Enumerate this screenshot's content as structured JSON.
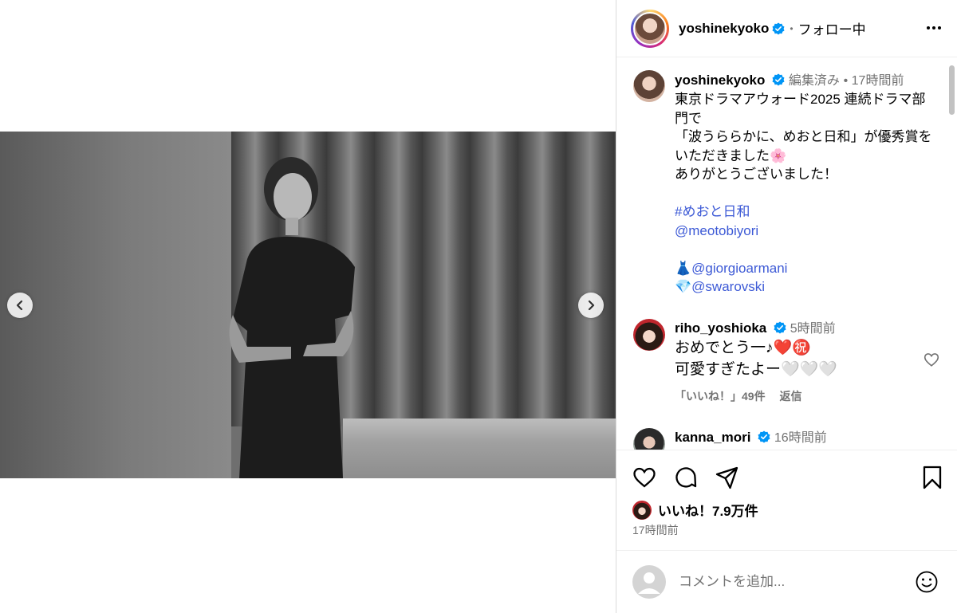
{
  "post_header": {
    "username": "yoshinekyoko",
    "follow_state": "フォロー中"
  },
  "caption": {
    "username": "yoshinekyoko",
    "edited": "編集済み",
    "time": "17時間前",
    "line1": "東京ドラマアウォード2025 連続ドラマ部門で",
    "line2": "「波うららかに、めおと日和」が優秀賞をいただきました🌸",
    "line3": "ありがとうございました！",
    "hashtag": "#めおと日和",
    "mention1": "@meotobiyori",
    "mention2_emoji": "👗",
    "mention2": "@giorgioarmani",
    "mention3_emoji": "💎",
    "mention3": "@swarovski"
  },
  "comments": [
    {
      "username": "riho_yoshioka",
      "time": "5時間前",
      "line1": "おめでとう一♪❤️㊗️",
      "line2": "可愛すぎたよー🤍🤍🤍",
      "likes": "「いいね！」49件",
      "reply": "返信"
    },
    {
      "username": "kanna_mori",
      "time": "16時間前"
    }
  ],
  "likes": {
    "label": "いいね！7.9万件"
  },
  "post_time": "17時間前",
  "comment_input": {
    "placeholder": "コメントを追加..."
  },
  "icons": [
    "verified-icon",
    "more-icon",
    "chevron-left-icon",
    "chevron-right-icon",
    "heart-icon",
    "comment-icon",
    "share-icon",
    "bookmark-icon",
    "emoji-icon"
  ],
  "colors": {
    "link": "#3d5ad6",
    "verified": "#0095f6",
    "secondary_text": "#737373"
  }
}
